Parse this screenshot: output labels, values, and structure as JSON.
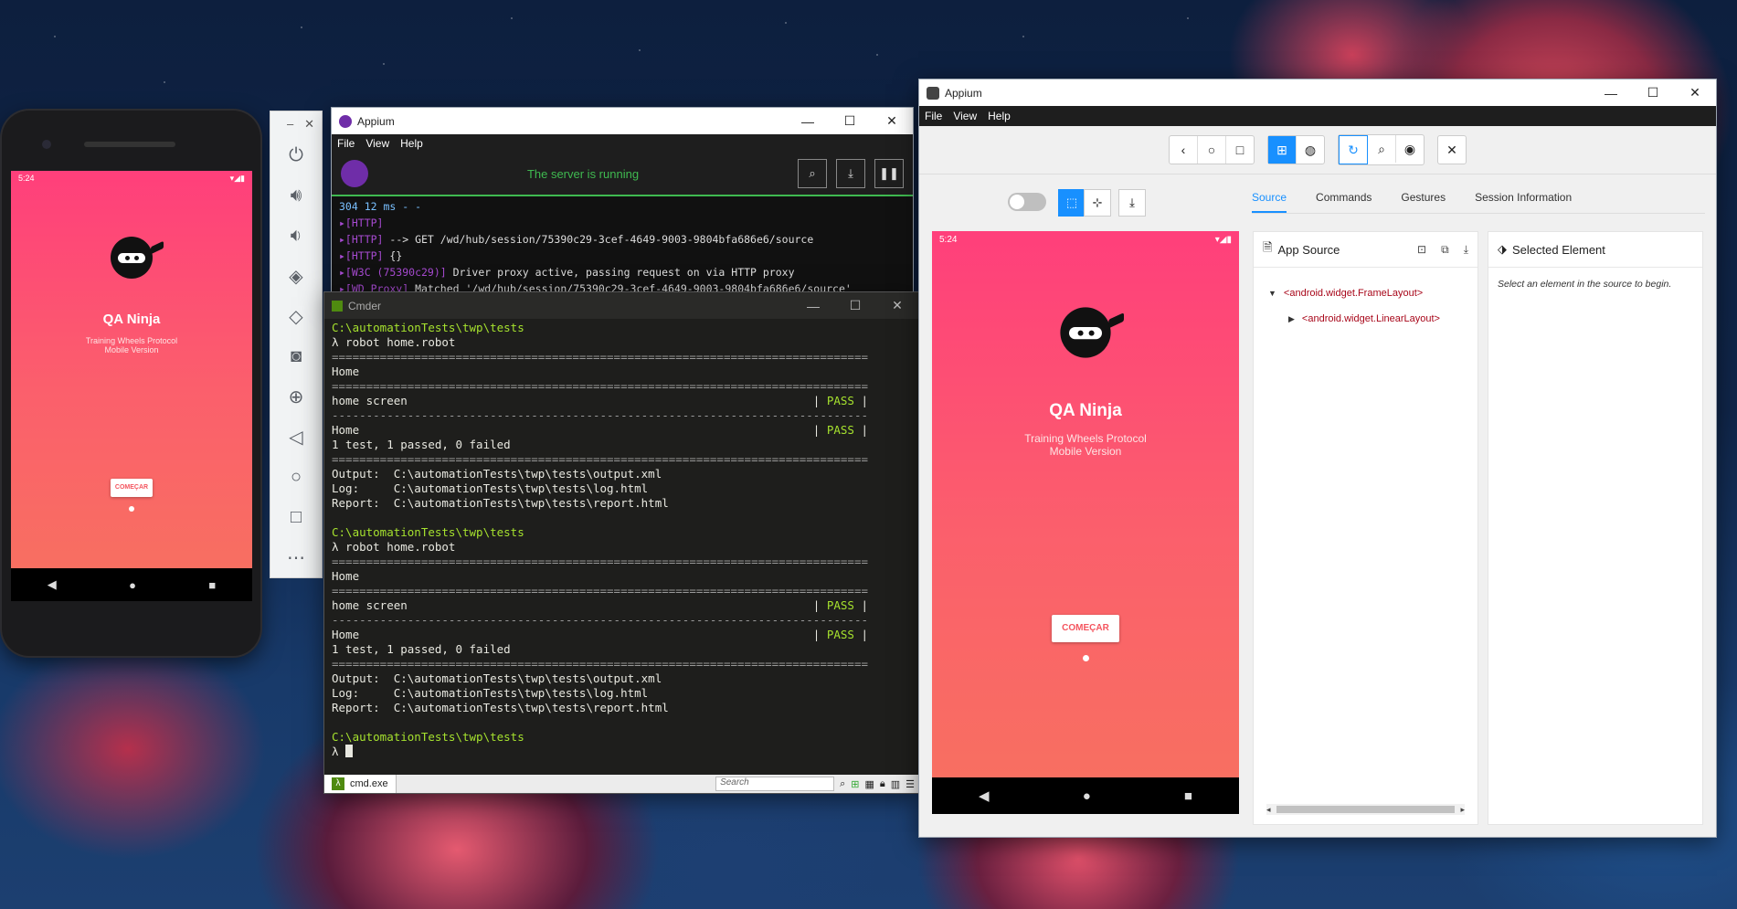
{
  "phone": {
    "status_time": "5:24",
    "app_title": "QA Ninja",
    "app_subtitle_1": "Training Wheels Protocol",
    "app_subtitle_2": "Mobile Version",
    "button_label": "COMEÇAR",
    "nav_back": "◀",
    "nav_home": "●",
    "nav_recent": "■"
  },
  "emulator_toolbar": {
    "minimize": "–",
    "close": "✕",
    "icons": [
      "power-icon",
      "volume-up-icon",
      "volume-down-icon",
      "rotate-left-icon",
      "rotate-right-icon",
      "camera-icon",
      "zoom-icon",
      "back-icon",
      "home-icon",
      "overview-icon",
      "more-icon"
    ]
  },
  "appium_server": {
    "title": "Appium",
    "menu": [
      "File",
      "View",
      "Help"
    ],
    "status": "The server is running",
    "log_lines": [
      {
        "tag": "",
        "text": "304 12 ms - -"
      },
      {
        "tag": "[HTTP]",
        "text": ""
      },
      {
        "tag": "[HTTP]",
        "text": " --> GET /wd/hub/session/75390c29-3cef-4649-9003-9804bfa686e6/source"
      },
      {
        "tag": "[HTTP]",
        "text": " {}"
      },
      {
        "tag": "[W3C (75390c29)]",
        "text": " Driver proxy active, passing request on via HTTP proxy"
      },
      {
        "tag": "[WD Proxy]",
        "text": " Matched '/wd/hub/session/75390c29-3cef-4649-9003-9804bfa686e6/source'"
      }
    ]
  },
  "cmder": {
    "title": "Cmder",
    "tab_label": "cmd.exe",
    "search_placeholder": "Search",
    "lines": [
      {
        "cls": "g",
        "text": "C:\\automationTests\\twp\\tests"
      },
      {
        "cls": "",
        "text": "λ robot home.robot"
      },
      {
        "cls": "dim",
        "text": "=============================================================================="
      },
      {
        "cls": "",
        "text": "Home"
      },
      {
        "cls": "dim",
        "text": "=============================================================================="
      },
      {
        "cls": "",
        "text": "home screen                                                           | PASS |"
      },
      {
        "cls": "dim",
        "text": "------------------------------------------------------------------------------"
      },
      {
        "cls": "",
        "text": "Home                                                                  | PASS |"
      },
      {
        "cls": "",
        "text": "1 test, 1 passed, 0 failed"
      },
      {
        "cls": "dim",
        "text": "=============================================================================="
      },
      {
        "cls": "",
        "text": "Output:  C:\\automationTests\\twp\\tests\\output.xml"
      },
      {
        "cls": "",
        "text": "Log:     C:\\automationTests\\twp\\tests\\log.html"
      },
      {
        "cls": "",
        "text": "Report:  C:\\automationTests\\twp\\tests\\report.html"
      },
      {
        "cls": "",
        "text": ""
      },
      {
        "cls": "g",
        "text": "C:\\automationTests\\twp\\tests"
      },
      {
        "cls": "",
        "text": "λ robot home.robot"
      },
      {
        "cls": "dim",
        "text": "=============================================================================="
      },
      {
        "cls": "",
        "text": "Home"
      },
      {
        "cls": "dim",
        "text": "=============================================================================="
      },
      {
        "cls": "",
        "text": "home screen                                                           | PASS |"
      },
      {
        "cls": "dim",
        "text": "------------------------------------------------------------------------------"
      },
      {
        "cls": "",
        "text": "Home                                                                  | PASS |"
      },
      {
        "cls": "",
        "text": "1 test, 1 passed, 0 failed"
      },
      {
        "cls": "dim",
        "text": "=============================================================================="
      },
      {
        "cls": "",
        "text": "Output:  C:\\automationTests\\twp\\tests\\output.xml"
      },
      {
        "cls": "",
        "text": "Log:     C:\\automationTests\\twp\\tests\\log.html"
      },
      {
        "cls": "",
        "text": "Report:  C:\\automationTests\\twp\\tests\\report.html"
      },
      {
        "cls": "",
        "text": ""
      },
      {
        "cls": "g",
        "text": "C:\\automationTests\\twp\\tests"
      },
      {
        "cls": "",
        "text": "λ "
      }
    ]
  },
  "inspector": {
    "title": "Appium",
    "menu": [
      "File",
      "View",
      "Help"
    ],
    "tabs": [
      "Source",
      "Commands",
      "Gestures",
      "Session Information"
    ],
    "app_source_title": "App Source",
    "selected_element_title": "Selected Element",
    "selected_hint": "Select an element in the source to begin.",
    "tree": [
      "<android.widget.FrameLayout>",
      "<android.widget.LinearLayout>"
    ],
    "screenshot": {
      "status_time": "5:24",
      "app_title": "QA Ninja",
      "app_subtitle_1": "Training Wheels Protocol",
      "app_subtitle_2": "Mobile Version",
      "button_label": "COMEÇAR"
    }
  },
  "colors": {
    "accent": "#1890ff",
    "server_green": "#3fb950",
    "app_pink": "#ff3f7b"
  }
}
